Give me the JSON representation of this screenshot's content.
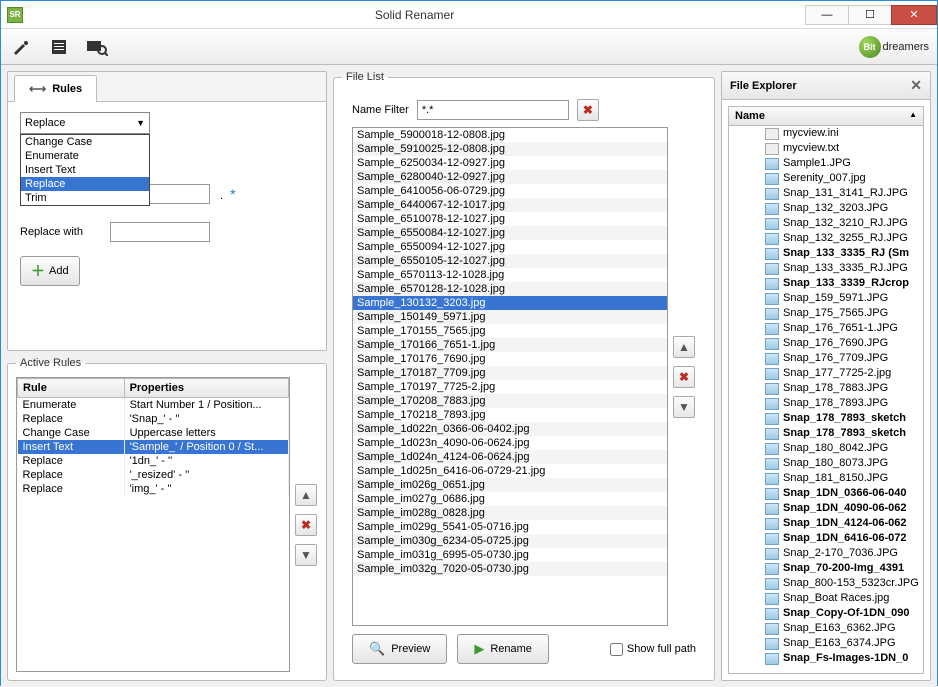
{
  "window": {
    "title": "Solid Renamer",
    "icon_label": "SR"
  },
  "brand": {
    "orb": "Bit",
    "name": "dreamers"
  },
  "toolbar": {
    "wrench": "🔧",
    "log": "📄",
    "search": "📷"
  },
  "tabs": {
    "rules": "Rules"
  },
  "dropdown": {
    "selected": "Replace",
    "options": [
      "Change Case",
      "Enumerate",
      "Insert Text",
      "Replace",
      "Trim"
    ],
    "selected_index": 3
  },
  "fields": {
    "replace_label": "",
    "replace_with_label": "Replace with",
    "replace_value": "",
    "replace_with_value": ""
  },
  "buttons": {
    "add": "Add",
    "preview": "Preview",
    "rename": "Rename",
    "show_full_path": "Show full path"
  },
  "active_rules": {
    "legend": "Active Rules",
    "cols": [
      "Rule",
      "Properties"
    ],
    "rows": [
      {
        "rule": "Enumerate",
        "props": "Start Number 1 / Position..."
      },
      {
        "rule": "Replace",
        "props": "'Snap_' - ''"
      },
      {
        "rule": "Change Case",
        "props": "Uppercase letters"
      },
      {
        "rule": "Insert Text",
        "props": "'Sample_' / Position 0 / St..."
      },
      {
        "rule": "Replace",
        "props": "'1dn_' - ''"
      },
      {
        "rule": "Replace",
        "props": "'_resized' - ''"
      },
      {
        "rule": "Replace",
        "props": "'img_' - ''"
      }
    ],
    "selected_index": 3
  },
  "filelist": {
    "legend": "File List",
    "filter_label": "Name Filter",
    "filter_value": "*.*",
    "selected_index": 12,
    "items": [
      "Sample_5900018-12-0808.jpg",
      "Sample_5910025-12-0808.jpg",
      "Sample_6250034-12-0927.jpg",
      "Sample_6280040-12-0927.jpg",
      "Sample_6410056-06-0729.jpg",
      "Sample_6440067-12-1017.jpg",
      "Sample_6510078-12-1027.jpg",
      "Sample_6550084-12-1027.jpg",
      "Sample_6550094-12-1027.jpg",
      "Sample_6550105-12-1027.jpg",
      "Sample_6570113-12-1028.jpg",
      "Sample_6570128-12-1028.jpg",
      "Sample_130132_3203.jpg",
      "Sample_150149_5971.jpg",
      "Sample_170155_7565.jpg",
      "Sample_170166_7651-1.jpg",
      "Sample_170176_7690.jpg",
      "Sample_170187_7709.jpg",
      "Sample_170197_7725-2.jpg",
      "Sample_170208_7883.jpg",
      "Sample_170218_7893.jpg",
      "Sample_1d022n_0366-06-0402.jpg",
      "Sample_1d023n_4090-06-0624.jpg",
      "Sample_1d024n_4124-06-0624.jpg",
      "Sample_1d025n_6416-06-0729-21.jpg",
      "Sample_im026g_0651.jpg",
      "Sample_im027g_0686.jpg",
      "Sample_im028g_0828.jpg",
      "Sample_im029g_5541-05-0716.jpg",
      "Sample_im030g_6234-05-0725.jpg",
      "Sample_im031g_6995-05-0730.jpg",
      "Sample_im032g_7020-05-0730.jpg"
    ]
  },
  "explorer": {
    "title": "File Explorer",
    "col": "Name",
    "items": [
      {
        "name": "mycview.ini",
        "type": "ini"
      },
      {
        "name": "mycview.txt",
        "type": "ini"
      },
      {
        "name": "Sample1.JPG"
      },
      {
        "name": "Serenity_007.jpg"
      },
      {
        "name": "Snap_131_3141_RJ.JPG"
      },
      {
        "name": "Snap_132_3203.JPG"
      },
      {
        "name": "Snap_132_3210_RJ.JPG"
      },
      {
        "name": "Snap_132_3255_RJ.JPG"
      },
      {
        "name": "Snap_133_3335_RJ (Sm",
        "bold": true
      },
      {
        "name": "Snap_133_3335_RJ.JPG"
      },
      {
        "name": "Snap_133_3339_RJcrop",
        "bold": true
      },
      {
        "name": "Snap_159_5971.JPG"
      },
      {
        "name": "Snap_175_7565.JPG"
      },
      {
        "name": "Snap_176_7651-1.JPG"
      },
      {
        "name": "Snap_176_7690.JPG"
      },
      {
        "name": "Snap_176_7709.JPG"
      },
      {
        "name": "Snap_177_7725-2.jpg"
      },
      {
        "name": "Snap_178_7883.JPG"
      },
      {
        "name": "Snap_178_7893.JPG"
      },
      {
        "name": "Snap_178_7893_sketch",
        "bold": true
      },
      {
        "name": "Snap_178_7893_sketch",
        "bold": true
      },
      {
        "name": "Snap_180_8042.JPG"
      },
      {
        "name": "Snap_180_8073.JPG"
      },
      {
        "name": "Snap_181_8150.JPG"
      },
      {
        "name": "Snap_1DN_0366-06-040",
        "bold": true
      },
      {
        "name": "Snap_1DN_4090-06-062",
        "bold": true
      },
      {
        "name": "Snap_1DN_4124-06-062",
        "bold": true
      },
      {
        "name": "Snap_1DN_6416-06-072",
        "bold": true
      },
      {
        "name": "Snap_2-170_7036.JPG"
      },
      {
        "name": "Snap_70-200-Img_4391",
        "bold": true
      },
      {
        "name": "Snap_800-153_5323cr.JPG"
      },
      {
        "name": "Snap_Boat Races.jpg"
      },
      {
        "name": "Snap_Copy-Of-1DN_090",
        "bold": true
      },
      {
        "name": "Snap_E163_6362.JPG"
      },
      {
        "name": "Snap_E163_6374.JPG"
      },
      {
        "name": "Snap_Fs-Images-1DN_0",
        "bold": true
      }
    ]
  }
}
